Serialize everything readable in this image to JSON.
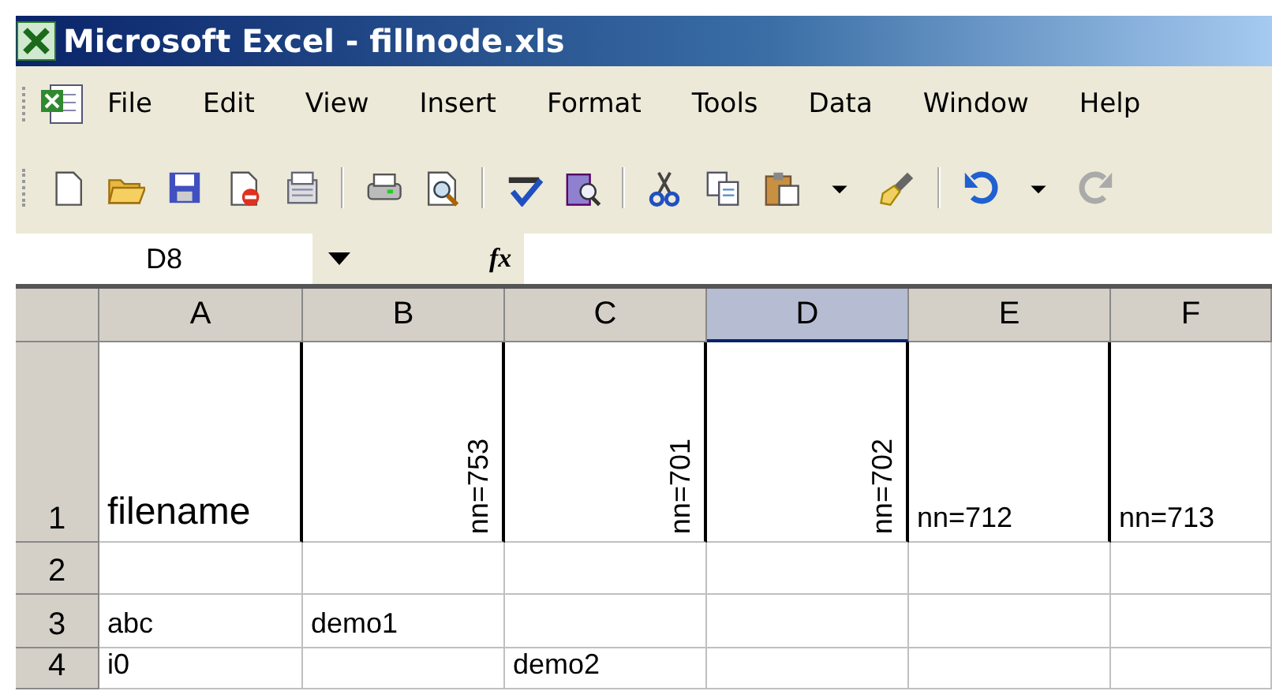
{
  "window": {
    "title": "Microsoft Excel - fillnode.xls"
  },
  "menu": [
    "File",
    "Edit",
    "View",
    "Insert",
    "Format",
    "Tools",
    "Data",
    "Window",
    "Help"
  ],
  "formula_bar": {
    "name_box": "D8",
    "fx": "fx"
  },
  "columns": [
    {
      "label": "A",
      "selected": false
    },
    {
      "label": "B",
      "selected": false
    },
    {
      "label": "C",
      "selected": false
    },
    {
      "label": "D",
      "selected": true
    },
    {
      "label": "E",
      "selected": false
    },
    {
      "label": "F",
      "selected": false
    }
  ],
  "rows": [
    {
      "number": "1",
      "cells": [
        {
          "text": "filename",
          "kind": "large"
        },
        {
          "text": "nn=753",
          "kind": "rotated"
        },
        {
          "text": "nn=701",
          "kind": "rotated"
        },
        {
          "text": "nn=702",
          "kind": "rotated"
        },
        {
          "text": "nn=712",
          "kind": "normal"
        },
        {
          "text": "nn=713",
          "kind": "normal"
        }
      ]
    },
    {
      "number": "2",
      "cells": []
    },
    {
      "number": "3",
      "cells": [
        {
          "text": "abc",
          "kind": "normal"
        },
        {
          "text": "demo1",
          "kind": "normal"
        }
      ]
    },
    {
      "number": "4",
      "cells": [
        {
          "text": "i0",
          "kind": "normal"
        },
        null,
        {
          "text": "demo2",
          "kind": "normal"
        }
      ]
    }
  ]
}
